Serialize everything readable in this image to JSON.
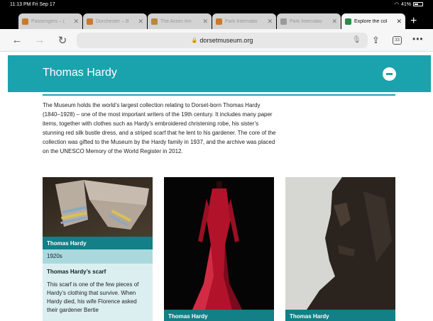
{
  "status": {
    "time": "11:13 PM  Fri Sep 17",
    "battery": "41%"
  },
  "tabs": [
    {
      "title": "Passengers – (",
      "color": "#c77a2e"
    },
    {
      "title": "Dorchester – B",
      "color": "#c77a2e"
    },
    {
      "title": "The Acorn Inn",
      "color": "#b58a3c"
    },
    {
      "title": "Park Internatio",
      "color": "#c77a2e"
    },
    {
      "title": "Park Internatio",
      "color": "#9a9a9a"
    },
    {
      "title": "Explore the col",
      "color": "#2a8a4a"
    }
  ],
  "toolbar": {
    "url": "dorsetmuseum.org",
    "tab_count": "33"
  },
  "section": {
    "title": "Thomas Hardy",
    "intro": "The Museum holds the world’s largest collection relating to Dorset-born Thomas Hardy (1840–1928) – one of the most important writers of the 19th century. It includes many paper items, together with clothes such as Hardy’s embroidered christening robe, his sister’s stunning red silk bustle dress, and a striped scarf that he lent to his gardener. The core of the collection was gifted to the Museum by the Hardy family in 1937, and the archive was placed on the UNESCO Memory of the World Register in 2012."
  },
  "cards": [
    {
      "caption": "Thomas Hardy",
      "date": "1920s",
      "name": "Thomas Hardy’s scarf",
      "desc": "This scarf is one of the few pieces of Hardy’s clothing that survive. When Hardy died, his wife Florence asked their gardener Bertie"
    },
    {
      "caption": "Thomas Hardy"
    },
    {
      "caption": "Thomas Hardy"
    }
  ]
}
